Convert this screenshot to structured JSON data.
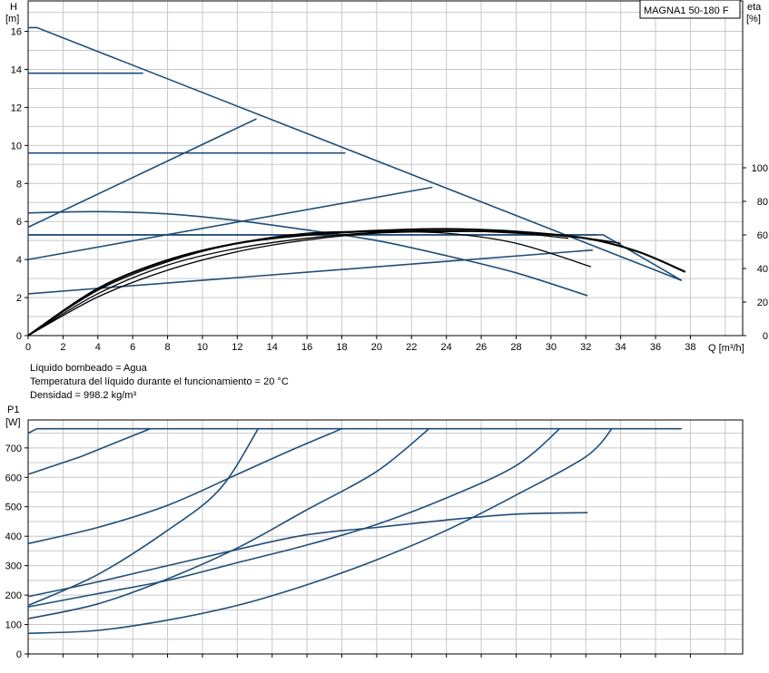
{
  "chart_data": [
    {
      "type": "line",
      "model_label": "MAGNA1 50-180 F",
      "ylabel_name": "H",
      "ylabel_unit": "[m]",
      "y2label_name": "eta",
      "y2label_unit": "[%]",
      "xlabel": "Q [m³/h]",
      "xlim": [
        0,
        41
      ],
      "ylim": [
        0,
        17.6
      ],
      "y2lim": [
        0,
        100
      ],
      "xticks": [
        "0",
        "2",
        "4",
        "6",
        "8",
        "10",
        "12",
        "14",
        "16",
        "18",
        "20",
        "22",
        "24",
        "26",
        "28",
        "30",
        "32",
        "34",
        "36",
        "38"
      ],
      "yticks": [
        "0",
        "2",
        "4",
        "6",
        "8",
        "10",
        "12",
        "14",
        "16"
      ],
      "y2ticks": [
        "0",
        "20",
        "40",
        "60",
        "80",
        "100"
      ],
      "grid": true,
      "series_head": [
        {
          "kind": "max-curve",
          "points": [
            [
              0,
              16.2
            ],
            [
              0.5,
              16.2
            ],
            [
              37.5,
              2.9
            ]
          ]
        },
        {
          "kind": "constant-pressure",
          "points": [
            [
              0,
              13.8
            ],
            [
              6.6,
              13.8
            ]
          ]
        },
        {
          "kind": "constant-pressure",
          "points": [
            [
              0,
              9.6
            ],
            [
              18.2,
              9.6
            ]
          ]
        },
        {
          "kind": "constant-pressure",
          "points": [
            [
              0,
              5.3
            ],
            [
              32.6,
              5.3
            ]
          ]
        },
        {
          "kind": "proportional-pressure",
          "points": [
            [
              0,
              5.7
            ],
            [
              13.1,
              11.4
            ]
          ]
        },
        {
          "kind": "proportional-pressure",
          "points": [
            [
              0,
              4.0
            ],
            [
              23.2,
              7.8
            ]
          ]
        },
        {
          "kind": "proportional-pressure",
          "points": [
            [
              0,
              2.2
            ],
            [
              32.4,
              4.5
            ]
          ]
        },
        {
          "kind": "curve",
          "points": [
            [
              0,
              6.45
            ],
            [
              4,
              6.52
            ],
            [
              8,
              6.4
            ],
            [
              12,
              6.05
            ],
            [
              16,
              5.55
            ],
            [
              20,
              5.0
            ],
            [
              24,
              4.2
            ],
            [
              28,
              3.3
            ],
            [
              32.1,
              2.1
            ]
          ]
        },
        {
          "kind": "curve",
          "points": [
            [
              0,
              5.3
            ],
            [
              33,
              5.3
            ],
            [
              37.5,
              2.9
            ]
          ]
        }
      ],
      "series_efficiency": [
        {
          "points": [
            [
              0,
              0
            ],
            [
              4,
              27
            ],
            [
              8,
              44
            ],
            [
              12,
              55
            ],
            [
              16,
              61
            ],
            [
              20,
              62
            ],
            [
              24,
              61
            ],
            [
              28,
              55
            ],
            [
              32.3,
              41
            ]
          ]
        },
        {
          "points": [
            [
              0,
              0
            ],
            [
              4,
              25
            ],
            [
              8,
              42
            ],
            [
              12,
              52
            ],
            [
              16,
              58
            ],
            [
              20,
              61.5
            ],
            [
              24,
              62.5
            ],
            [
              28,
              61
            ],
            [
              31,
              58
            ]
          ]
        },
        {
          "points": [
            [
              0,
              0
            ],
            [
              4,
              23
            ],
            [
              8,
              39
            ],
            [
              12,
              50
            ],
            [
              16,
              57
            ],
            [
              20,
              61
            ],
            [
              24,
              62
            ],
            [
              28,
              61.5
            ],
            [
              32,
              58
            ],
            [
              34,
              55
            ]
          ]
        },
        {
          "points": [
            [
              0,
              0
            ],
            [
              4,
              28
            ],
            [
              8,
              45
            ],
            [
              12,
              55
            ],
            [
              16,
              60
            ],
            [
              20,
              62.5
            ],
            [
              24,
              63.5
            ],
            [
              28,
              62
            ],
            [
              32,
              58
            ],
            [
              35,
              50
            ],
            [
              37.7,
              38
            ]
          ]
        }
      ],
      "fluid_info": [
        "Líquido bombeado = Agua",
        "Temperatura del líquido durante el funcionamiento = 20 °C",
        "Densidad = 998.2 kg/m³"
      ]
    },
    {
      "type": "line",
      "ylabel_name": "P1",
      "ylabel_unit": "[W]",
      "xlim": [
        0,
        41
      ],
      "ylim": [
        0,
        795
      ],
      "yticks": [
        "0",
        "100",
        "200",
        "300",
        "400",
        "500",
        "600",
        "700"
      ],
      "grid": true,
      "series_power": [
        {
          "kind": "max-curve",
          "points": [
            [
              0,
              750
            ],
            [
              0.5,
              765
            ],
            [
              37.5,
              765
            ]
          ]
        },
        {
          "kind": "curve",
          "points": [
            [
              0,
              610
            ],
            [
              3,
              670
            ],
            [
              7,
              765
            ]
          ]
        },
        {
          "kind": "curve",
          "points": [
            [
              0,
              375
            ],
            [
              4,
              430
            ],
            [
              8,
              505
            ],
            [
              12,
              610
            ],
            [
              15,
              690
            ],
            [
              18,
              765
            ]
          ]
        },
        {
          "kind": "curve",
          "points": [
            [
              0,
              165
            ],
            [
              4,
              270
            ],
            [
              8,
              420
            ],
            [
              11,
              560
            ],
            [
              13.2,
              765
            ]
          ]
        },
        {
          "kind": "curve",
          "points": [
            [
              0,
              120
            ],
            [
              4,
              170
            ],
            [
              8,
              255
            ],
            [
              12,
              360
            ],
            [
              16,
              490
            ],
            [
              20,
              620
            ],
            [
              23,
              765
            ]
          ]
        },
        {
          "kind": "curve",
          "points": [
            [
              0,
              195
            ],
            [
              4,
              245
            ],
            [
              8,
              300
            ],
            [
              12,
              355
            ],
            [
              16,
              405
            ],
            [
              20,
              430
            ],
            [
              24,
              455
            ],
            [
              28,
              475
            ],
            [
              32.1,
              480
            ]
          ]
        },
        {
          "kind": "curve",
          "points": [
            [
              0,
              160
            ],
            [
              4,
              205
            ],
            [
              8,
              250
            ],
            [
              12,
              310
            ],
            [
              16,
              370
            ],
            [
              20,
              440
            ],
            [
              24,
              530
            ],
            [
              28,
              640
            ],
            [
              30.5,
              765
            ]
          ]
        },
        {
          "kind": "curve",
          "points": [
            [
              0,
              70
            ],
            [
              4,
              80
            ],
            [
              8,
              115
            ],
            [
              12,
              165
            ],
            [
              16,
              235
            ],
            [
              20,
              320
            ],
            [
              24,
              420
            ],
            [
              28,
              540
            ],
            [
              32,
              670
            ],
            [
              33.5,
              765
            ]
          ]
        }
      ]
    }
  ]
}
